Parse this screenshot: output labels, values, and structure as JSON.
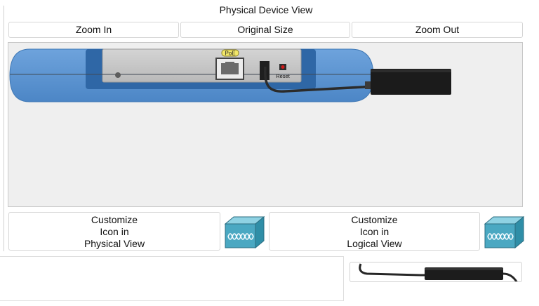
{
  "title": "Physical Device View",
  "zoom": {
    "zoom_in": "Zoom In",
    "original_size": "Original Size",
    "zoom_out": "Zoom Out"
  },
  "device": {
    "poe_label": "PoE",
    "reset_label": "Reset"
  },
  "customize_physical": {
    "line1": "Customize",
    "line2": "Icon in",
    "line3": "Physical View"
  },
  "customize_logical": {
    "line1": "Customize",
    "line2": "Icon in",
    "line3": "Logical View"
  },
  "colors": {
    "device_blue": "#5b93cf",
    "device_dark_blue": "#2d68ab",
    "faceplate": "#c9c9c9",
    "icon_teal": "#4aa8c2"
  }
}
